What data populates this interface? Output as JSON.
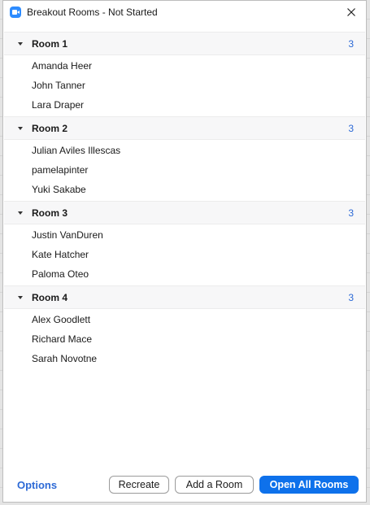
{
  "window": {
    "title": "Breakout Rooms - Not Started",
    "app_icon": "zoom-camera-icon",
    "close_icon": "close-icon"
  },
  "rooms": [
    {
      "name": "Room 1",
      "count": "3",
      "participants": [
        "Amanda Heer",
        "John Tanner",
        "Lara Draper"
      ]
    },
    {
      "name": "Room 2",
      "count": "3",
      "participants": [
        "Julian Aviles Illescas",
        "pamelapinter",
        "Yuki Sakabe"
      ]
    },
    {
      "name": "Room 3",
      "count": "3",
      "participants": [
        "Justin VanDuren",
        "Kate Hatcher",
        "Paloma Oteo"
      ]
    },
    {
      "name": "Room 4",
      "count": "3",
      "participants": [
        "Alex Goodlett",
        "Richard Mace",
        "Sarah Novotne"
      ]
    }
  ],
  "footer": {
    "options_label": "Options",
    "recreate_label": "Recreate",
    "add_room_label": "Add a Room",
    "open_all_label": "Open All Rooms"
  },
  "colors": {
    "accent": "#0e71eb",
    "link": "#2d6ad6",
    "room_header_bg": "#f7f7f8"
  }
}
